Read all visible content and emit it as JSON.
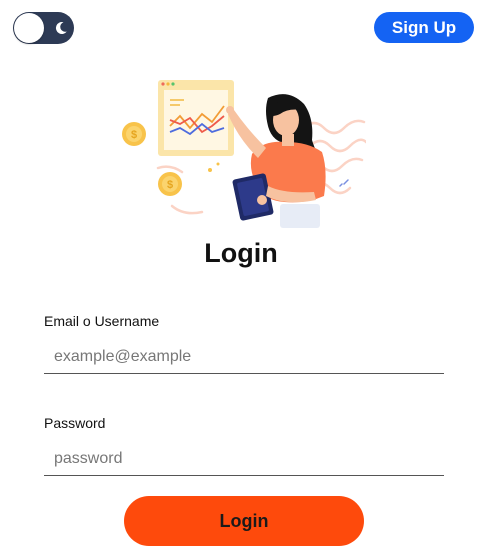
{
  "header": {
    "theme_toggle_state": "light",
    "signup_label": "Sign Up"
  },
  "main": {
    "title": "Login",
    "email": {
      "label": "Email o Username",
      "placeholder": "example@example",
      "value": ""
    },
    "password": {
      "label": "Password",
      "placeholder": "password",
      "value": ""
    },
    "login_label": "Login"
  },
  "icons": {
    "toggle": "moon-icon",
    "illustration": "woman-presenting-chart-illustration"
  },
  "colors": {
    "toggle_track": "#2d3a55",
    "signup_button": "#1463f3",
    "login_button": "#fe4a0c",
    "woman_shirt": "#fb7a4c",
    "coin": "#f8c34a"
  }
}
